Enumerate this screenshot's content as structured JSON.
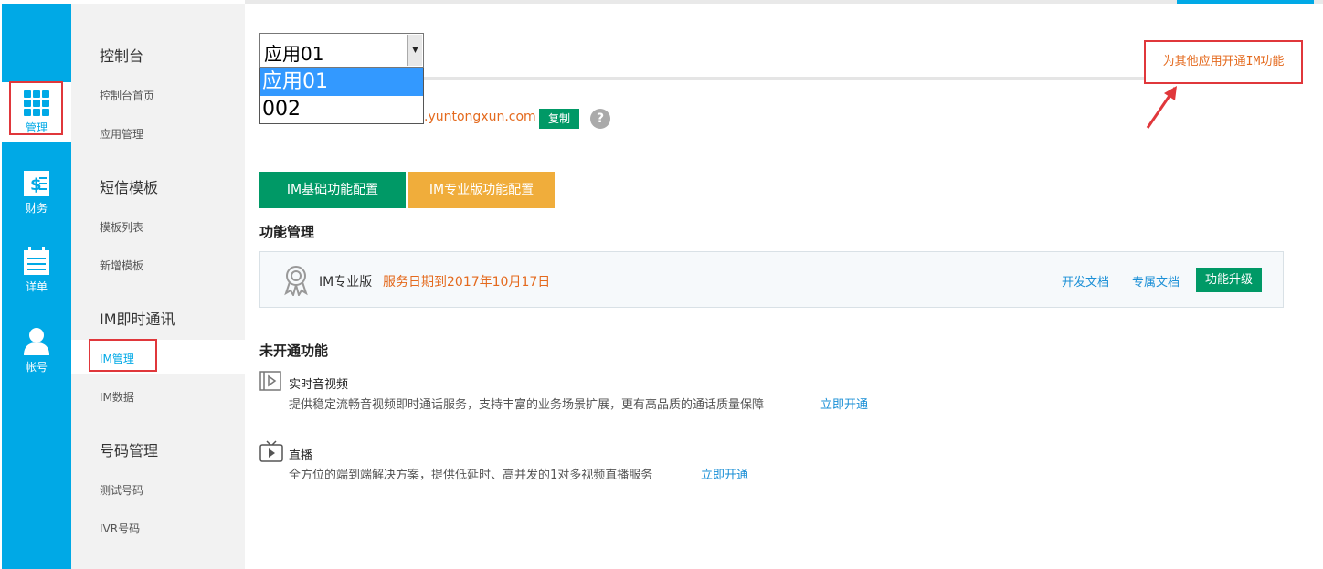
{
  "rail": {
    "items": [
      {
        "label": "管理",
        "icon": "grid-icon"
      },
      {
        "label": "财务",
        "icon": "finance-icon"
      },
      {
        "label": "详单",
        "icon": "calendar-icon"
      },
      {
        "label": "帐号",
        "icon": "user-icon"
      }
    ]
  },
  "sidebar": {
    "groups": [
      {
        "title": "控制台",
        "items": [
          "控制台首页",
          "应用管理"
        ]
      },
      {
        "title": "短信模板",
        "items": [
          "模板列表",
          "新增模板"
        ]
      },
      {
        "title": "IM即时通讯",
        "items": [
          "IM管理",
          "IM数据"
        ]
      },
      {
        "title": "号码管理",
        "items": [
          "测试号码",
          "IVR号码"
        ]
      }
    ]
  },
  "app_select": {
    "value": "应用01",
    "options": [
      "应用01",
      "002"
    ]
  },
  "app_info": {
    "url_fragment": ".yuntongxun.com",
    "copy_label": "复制",
    "help": "?"
  },
  "tabs": [
    "IM基础功能配置",
    "IM专业版功能配置"
  ],
  "function_mgmt": {
    "title": "功能管理",
    "plan": "IM专业版",
    "expire": "服务日期到2017年10月17日",
    "doc_link": "开发文档",
    "exclusive_doc_link": "专属文档",
    "upgrade_label": "功能升级"
  },
  "unopened": {
    "title": "未开通功能",
    "features": [
      {
        "name": "实时音视频",
        "desc": "提供稳定流畅音视频即时通话服务，支持丰富的业务场景扩展，更有高品质的通话质量保障",
        "action": "立即开通"
      },
      {
        "name": "直播",
        "desc": "全方位的端到端解决方案，提供低延时、高并发的1对多视频直播服务",
        "action": "立即开通"
      }
    ]
  },
  "annotation": "为其他应用开通IM功能",
  "colors": {
    "rail": "#00a9e6",
    "primary_green": "#009966",
    "orange_tab": "#f0ad3b",
    "highlight_red": "#e0373b",
    "link_blue": "#1a8fd6",
    "warn_orange": "#e46a1e"
  }
}
